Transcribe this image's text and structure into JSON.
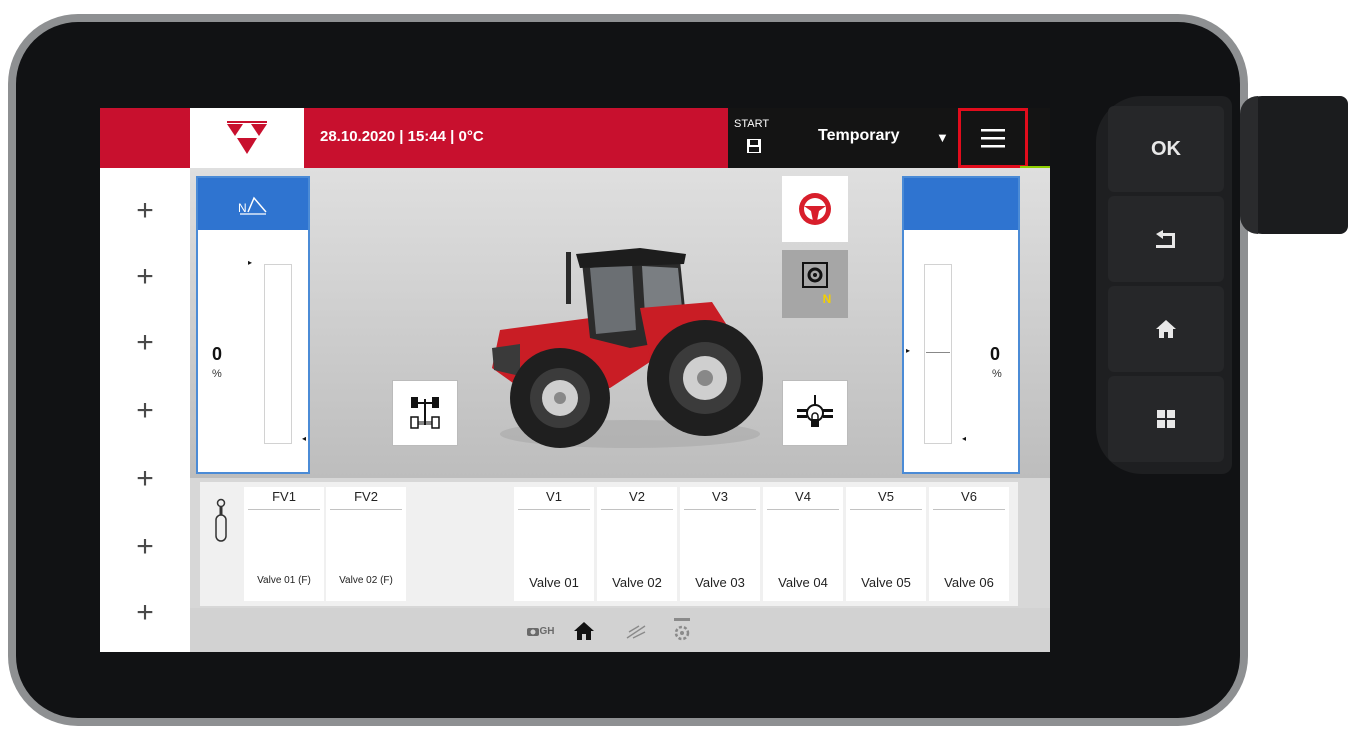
{
  "device": {
    "side_buttons": [
      {
        "label": "OK",
        "icon": "ok-button"
      },
      {
        "label": "",
        "icon": "back-icon"
      },
      {
        "label": "",
        "icon": "home-icon"
      },
      {
        "label": "",
        "icon": "apps-grid-icon"
      }
    ]
  },
  "header": {
    "datetime": "28.10.2020 | 15:44 | 0°C",
    "start_label": "START",
    "profile": "Temporary",
    "dropdown_glyph": "▼",
    "brand_color": "#c8102e",
    "highlight_color": "#e10c1c"
  },
  "left_gauge": {
    "value": "0",
    "unit": "%",
    "level": 0,
    "header_icon": "N"
  },
  "right_gauge": {
    "value": "0",
    "unit": "%",
    "level": 0
  },
  "gear_status": "N",
  "valves": [
    {
      "label": "FV1",
      "name": "Valve 01 (F)"
    },
    {
      "label": "FV2",
      "name": "Valve 02 (F)"
    },
    {
      "label": "V1",
      "name": "Valve 01"
    },
    {
      "label": "V2",
      "name": "Valve 02"
    },
    {
      "label": "V3",
      "name": "Valve 03"
    },
    {
      "label": "V4",
      "name": "Valve 04"
    },
    {
      "label": "V5",
      "name": "Valve 05"
    },
    {
      "label": "V6",
      "name": "Valve 06"
    }
  ],
  "nav": [
    {
      "icon": "camera-icon",
      "label": "GH"
    },
    {
      "icon": "home-icon",
      "label": ""
    },
    {
      "icon": "implement-icon",
      "label": ""
    },
    {
      "icon": "settings-icon",
      "label": ""
    }
  ]
}
